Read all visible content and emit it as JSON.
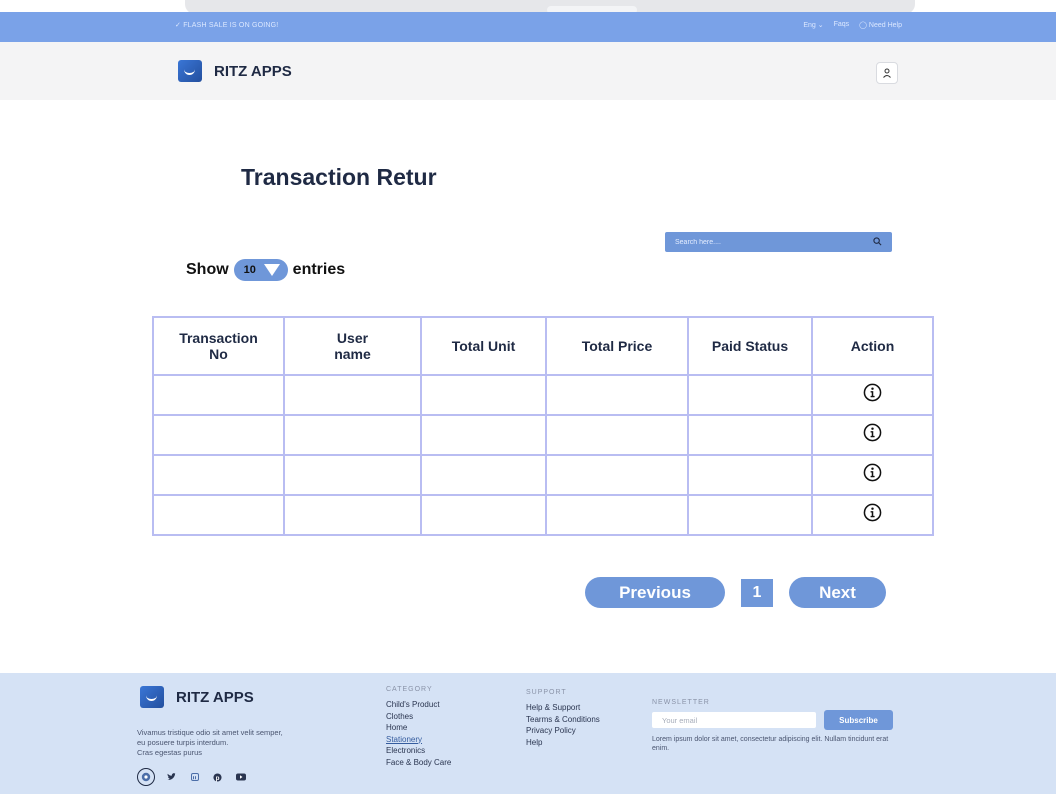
{
  "topbar": {
    "flash_sale": "✓  FLASH SALE IS ON GOING!",
    "language": "Eng ⌄",
    "faqs": "Faqs",
    "help": "◯ Need Help"
  },
  "header": {
    "brand": "RITZ APPS",
    "user_icon": "user-icon"
  },
  "main": {
    "title": "Transaction Retur",
    "search_placeholder": "Search here....",
    "show_label": "Show",
    "entries_value": "10",
    "entries_label": "entries"
  },
  "table": {
    "headers": [
      {
        "line1": "Transaction",
        "line2": "No"
      },
      {
        "line1": "User",
        "line2": "name"
      },
      {
        "line1": "Total Unit",
        "line2": ""
      },
      {
        "line1": "Total Price",
        "line2": ""
      },
      {
        "line1": "Paid Status",
        "line2": ""
      },
      {
        "line1": "Action",
        "line2": ""
      }
    ],
    "row_count": 4,
    "action_icon": "info-icon"
  },
  "pagination": {
    "previous": "Previous",
    "page": "1",
    "next": "Next"
  },
  "footer": {
    "brand": "RITZ APPS",
    "description": [
      "Vivamus tristique odio sit amet velit semper,",
      "eu posuere turpis interdum.",
      "Cras egestas purus"
    ],
    "socials": [
      "instagram-icon",
      "twitter-icon",
      "linkedin-icon",
      "pinterest-icon",
      "youtube-icon"
    ],
    "category_heading": "CATEGORY",
    "categories": [
      "Child's Product",
      "Clothes",
      "Home",
      "Stationery",
      "Electronics",
      "Face & Body Care"
    ],
    "support_heading": "SUPPORT",
    "support": [
      "Help & Support",
      "Tearms & Conditions",
      "Privacy Policy",
      "Help"
    ],
    "newsletter_heading": "NEWSLETTER",
    "email_placeholder": "Your email",
    "subscribe": "Subscribe",
    "newsletter_text": "Lorem ipsum dolor sit amet, consectetur adipiscing elit. Nullam tincidunt erat enim."
  },
  "colors": {
    "accent": "#6f97d9",
    "topbar": "#7aa2e8",
    "footer_bg": "#d5e2f5",
    "table_border": "#b9bdf2"
  }
}
